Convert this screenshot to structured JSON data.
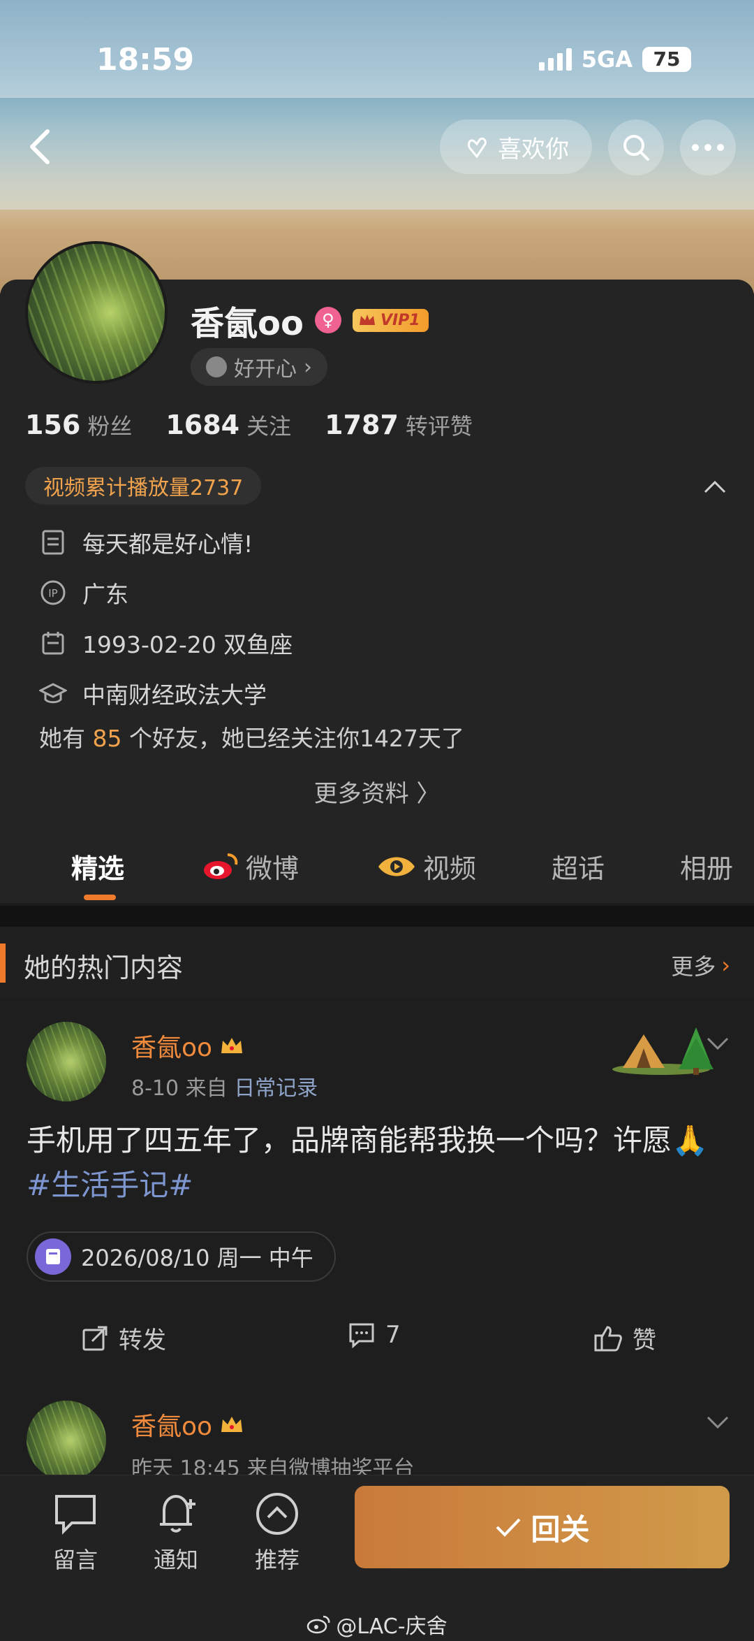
{
  "status": {
    "time": "18:59",
    "network": "5GA",
    "battery": "75"
  },
  "header": {
    "like_label": "喜欢你"
  },
  "profile": {
    "name": "香氤oo",
    "vip_label": "VIP1",
    "mood": "好开心",
    "stats": [
      {
        "num": "156",
        "label": "粉丝"
      },
      {
        "num": "1684",
        "label": "关注"
      },
      {
        "num": "1787",
        "label": "转评赞"
      }
    ],
    "video_views": "视频累计播放量2737",
    "bio": "每天都是好心情!",
    "ip_location": "广东",
    "birthday": "1993-02-20 双鱼座",
    "school": "中南财经政法大学",
    "friends_prefix": "她有",
    "friends_count": "85",
    "friends_suffix": "个好友，她已经关注你1427天了",
    "more_info": "更多资料 〉"
  },
  "tabs": [
    "精选",
    "微博",
    "视频",
    "超话",
    "相册"
  ],
  "section": {
    "title": "她的热门内容",
    "more": "更多"
  },
  "posts": [
    {
      "name": "香氤oo",
      "date": "8-10",
      "from_label": "来自",
      "source": "日常记录",
      "text_main": "手机用了四五年了，品牌商能帮我换一个吗？许愿",
      "text_emoji": "🙏",
      "text_tag": "#生活手记#",
      "date_chip": "2026/08/10 周一 中午",
      "repost_label": "转发",
      "comment_count": "7",
      "like_label": "赞"
    },
    {
      "name": "香氤oo",
      "meta": "昨天 18:45  来自微博抽奖平台"
    }
  ],
  "bottom_bar": {
    "message": "留言",
    "notify": "通知",
    "recommend": "推荐",
    "follow_back": "回关"
  },
  "watermark": "@LAC-庆舍"
}
